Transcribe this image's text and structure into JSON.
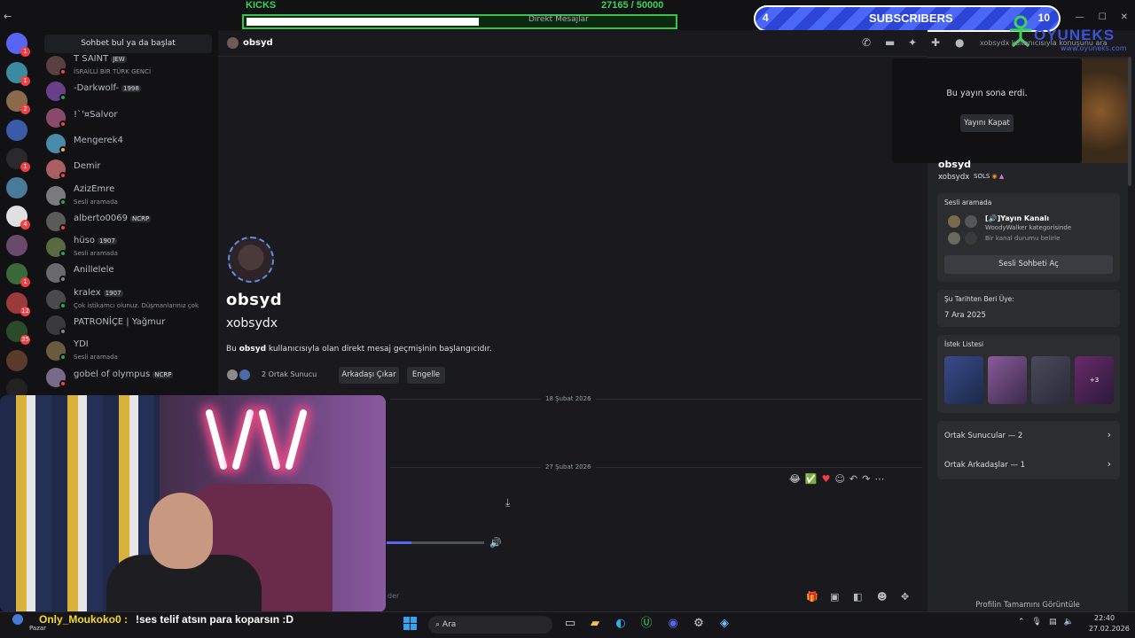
{
  "overlay": {
    "kicks_label": "KICKS",
    "kicks_count": "27165 / 50000",
    "kicks_progress": 0.543,
    "subs_current": "4",
    "subs_label": "SUBSCRIBERS",
    "subs_goal": "10",
    "logo_text": "OYUNEKS",
    "logo_url": "www.oyuneks.com"
  },
  "window": {
    "title": "Direkt Mesajlar"
  },
  "sidebar": {
    "search_label": "Sohbet bul ya da başlat",
    "friends": [
      {
        "name": "T SAINT",
        "tag": "JEW",
        "sub": "İSRAİLLİ BİR TÜRK GENCİ",
        "color": "#5a4040",
        "status": "#f23f43"
      },
      {
        "name": "-Darkwolf-",
        "tag": "1998",
        "sub": "",
        "color": "#6a3f8a",
        "status": "#23a55a"
      },
      {
        "name": "!`'¤Salvor",
        "tag": "",
        "sub": "",
        "color": "#8a4a6a",
        "status": "#f23f43"
      },
      {
        "name": "Mengerek4",
        "tag": "",
        "sub": "",
        "color": "#4a8aaa",
        "status": "#f0b232"
      },
      {
        "name": "Demir",
        "tag": "",
        "sub": "",
        "color": "#aa6060",
        "status": "#f23f43"
      },
      {
        "name": "AzizEmre",
        "tag": "",
        "sub": "Sesli aramada",
        "color": "#7a7a7a",
        "status": "#23a55a"
      },
      {
        "name": "alberto0069",
        "tag": "NCRP",
        "sub": "",
        "color": "#5a5a5a",
        "status": "#f23f43"
      },
      {
        "name": "hüso",
        "tag": "1907",
        "sub": "Sesli aramada",
        "color": "#5a6a40",
        "status": "#23a55a"
      },
      {
        "name": "Anillelele",
        "tag": "",
        "sub": "",
        "color": "#6a6a6a",
        "status": "#80848e"
      },
      {
        "name": "kralex",
        "tag": "1907",
        "sub": "Çok istikamcı olunuz. Düşmanlarınız çok",
        "color": "#4a4a4a",
        "status": "#23a55a"
      },
      {
        "name": "PATRONİÇE | Yağmur",
        "tag": "",
        "sub": "",
        "color": "#3a3a3a",
        "status": "#80848e"
      },
      {
        "name": "YDI",
        "tag": "",
        "sub": "Sesli aramada",
        "color": "#6a5a40",
        "status": "#23a55a"
      },
      {
        "name": "gobel of olympus",
        "tag": "NCRP",
        "sub": "",
        "color": "#7a6a8a",
        "status": "#f23f43"
      }
    ]
  },
  "header": {
    "name": "obsyd",
    "search_placeholder": "xobsydx kullanıcısıyla konuşunu ara"
  },
  "chat": {
    "display_name": "obsyd",
    "username": "xobsydx",
    "intro_before": "Bu ",
    "intro_name": "obsyd",
    "intro_after": " kullanıcısıyla olan direkt mesaj geçmişinin başlangıcıdır.",
    "mutual_servers": "2 Ortak Sunucu",
    "remove_friend": "Arkadaşı Çıkar",
    "block": "Engelle",
    "date1": "18 Şubat 2026",
    "date2": "27 Şubat 2026",
    "composer_placeholder": "der",
    "audio_progress": 0.25
  },
  "profile": {
    "stream_ended": "Bu yayın sona erdi.",
    "close_stream": "Yayını Kapat",
    "display_name": "obsyd",
    "username": "xobsydx",
    "badge": "SOLS",
    "voice_title": "Sesli aramada",
    "voice_channel": "[🔊]Yayın Kanalı",
    "voice_category": "WoodyWalker kategorisinde",
    "voice_status": "Bir kanal durumu belirle",
    "open_voice": "Sesli Sohbeti Aç",
    "member_since_title": "Şu Tarihten Beri Üye:",
    "member_since": "7 Ara 2025",
    "wishlist_title": "İstek Listesi",
    "wishlist_more": "+3",
    "mutual_servers": "Ortak Sunucular — 2",
    "mutual_friends": "Ortak Arkadaşlar — 1",
    "view_full": "Profilin Tamamını Görüntüle"
  },
  "stream_chat": {
    "user": "Only_Moukoko0 :",
    "message": "!ses telif atsın para koparsın :D"
  },
  "taskbar": {
    "day": "Pazar",
    "search": "Ara",
    "time": "22:40",
    "date": "27.02.2026"
  },
  "guild_badges": [
    "1",
    "1",
    "2",
    "",
    "1",
    "",
    "4",
    "",
    "1",
    "12",
    "35",
    "",
    "",
    "",
    ""
  ]
}
